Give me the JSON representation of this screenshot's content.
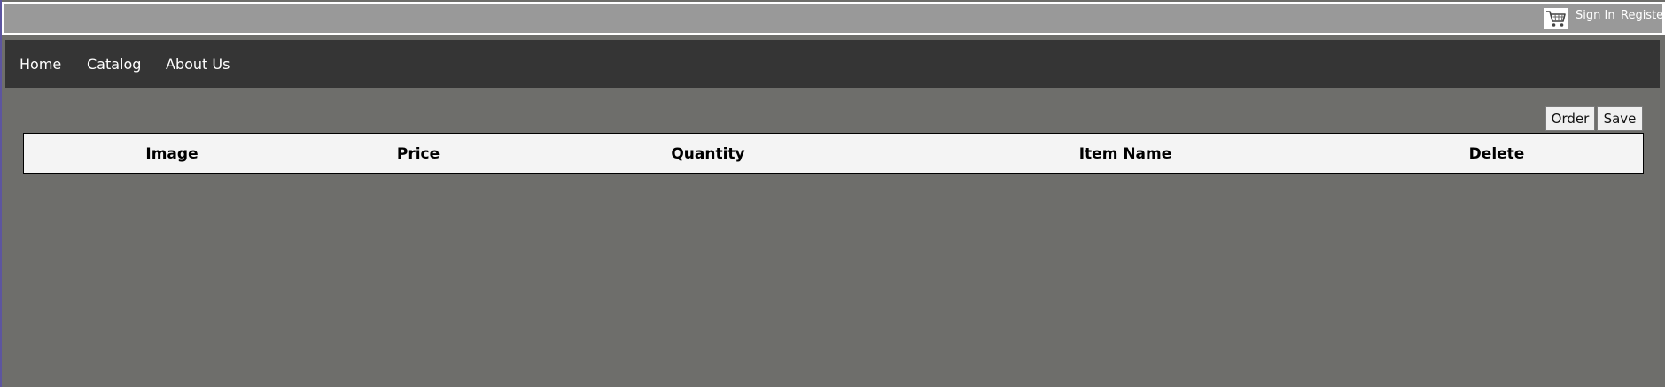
{
  "header": {
    "cart_icon": "shopping-cart-icon",
    "sign_in": "Sign In",
    "register": "Register"
  },
  "nav": {
    "home": "Home",
    "catalog": "Catalog",
    "about": "About Us"
  },
  "actions": {
    "order": "Order",
    "save": "Save"
  },
  "table": {
    "columns": [
      "Image",
      "Price",
      "Quantity",
      "Item Name",
      "Delete"
    ],
    "rows": []
  },
  "colors": {
    "page_background": "#6e6e6b",
    "top_bar": "#999999",
    "nav_bar": "#353535",
    "table_header": "#f4f4f4"
  }
}
